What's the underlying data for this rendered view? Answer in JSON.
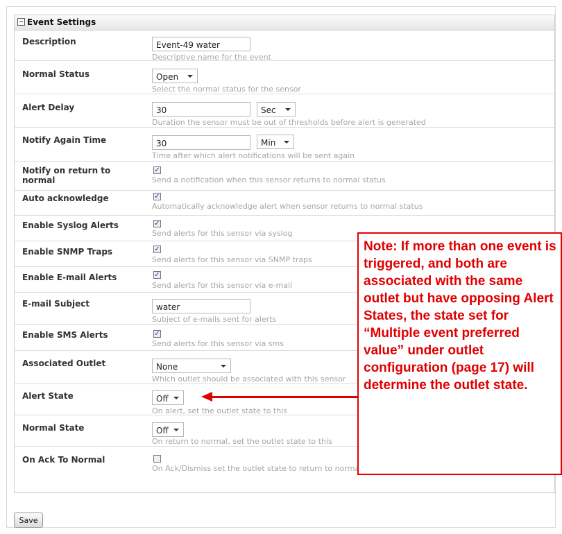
{
  "panel": {
    "title": "Event Settings"
  },
  "fields": {
    "description": {
      "label": "Description",
      "value": "Event-49 water",
      "help": "Descriptive name for the event"
    },
    "normal_status": {
      "label": "Normal Status",
      "value": "Open",
      "help": "Select the normal status for the sensor"
    },
    "alert_delay": {
      "label": "Alert Delay",
      "value": "30",
      "unit": "Sec",
      "help": "Duration the sensor must be out of thresholds before alert is generated"
    },
    "notify_again": {
      "label": "Notify Again Time",
      "value": "30",
      "unit": "Min",
      "help": "Time after which alert notifications will be sent again"
    },
    "notify_return": {
      "label": "Notify on return to normal",
      "checked": true,
      "help": "Send a notification when this sensor returns to normal status"
    },
    "auto_ack": {
      "label": "Auto acknowledge",
      "checked": true,
      "help": "Automatically acknowledge alert when sensor returns to normal status"
    },
    "syslog": {
      "label": "Enable Syslog Alerts",
      "checked": true,
      "help": "Send alerts for this sensor via syslog"
    },
    "snmp": {
      "label": "Enable SNMP Traps",
      "checked": true,
      "help": "Send alerts for this sensor via SNMP traps"
    },
    "email": {
      "label": "Enable E-mail Alerts",
      "checked": true,
      "help": "Send alerts for this sensor via e-mail"
    },
    "email_subject": {
      "label": "E-mail Subject",
      "value": "water",
      "help": "Subject of e-mails sent for alerts"
    },
    "sms": {
      "label": "Enable SMS Alerts",
      "checked": true,
      "help": "Send alerts for this sensor via sms"
    },
    "outlet": {
      "label": "Associated Outlet",
      "value": "None",
      "help": "Which outlet should be associated with this sensor"
    },
    "alert_state": {
      "label": "Alert State",
      "value": "Off",
      "help": "On alert, set the outlet state to this"
    },
    "normal_state": {
      "label": "Normal State",
      "value": "Off",
      "help": "On return to normal, set the outlet state to this"
    },
    "ack_normal": {
      "label": "On Ack To Normal",
      "checked": false,
      "help": "On Ack/Dismiss set the outlet state to return to normal action"
    }
  },
  "buttons": {
    "save": "Save"
  },
  "check_mark": "✓",
  "annotation": {
    "note": "Note: If more than one event is triggered, and both are associated with the same outlet but have opposing Alert States, the state set for “Multiple event preferred value” under outlet configuration (page 17) will determine the outlet state.",
    "color": "#e00000"
  }
}
